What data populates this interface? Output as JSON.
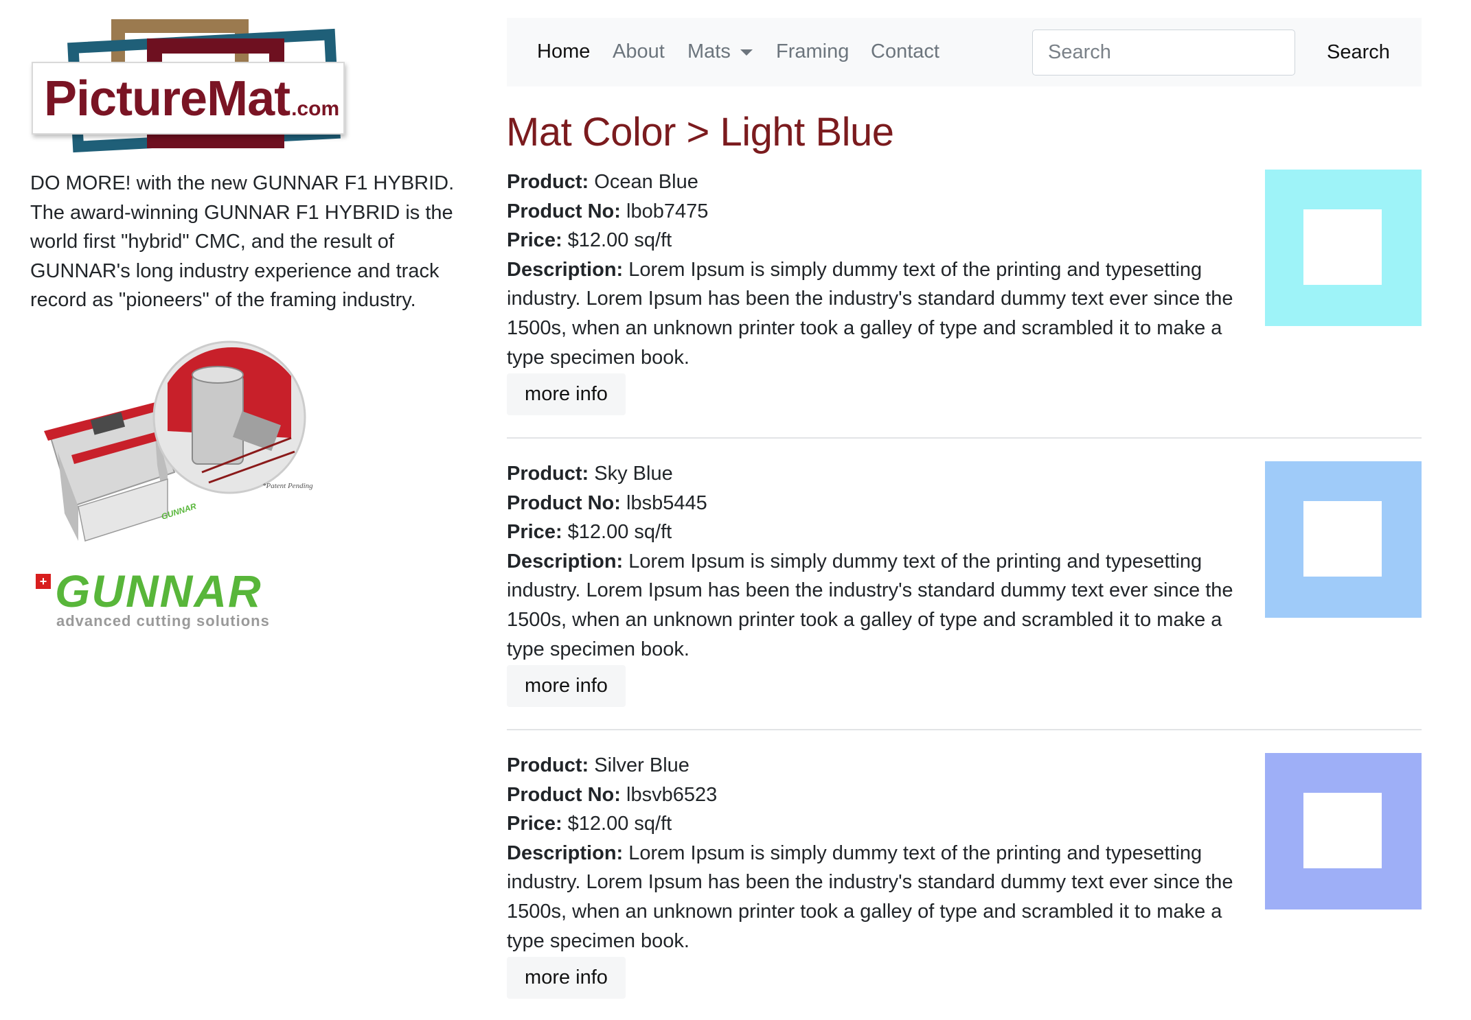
{
  "brand": {
    "logo_word": "PictureMat",
    "logo_suffix": ".com",
    "logo_colors": {
      "maroon": "#7a1424",
      "teal": "#1f5f78",
      "tan": "#9b7a4f"
    }
  },
  "sidebar": {
    "promo_text": "DO MORE! with the new GUNNAR F1 HYBRID. The award-winning GUNNAR F1 HYBRID is the world first \"hybrid\" CMC, and the result of GUNNAR's long industry experience and track record as \"pioneers\" of the framing industry.",
    "ad": {
      "brand_name": "GUNNAR",
      "tagline": "advanced cutting solutions",
      "patent_note": "*Patent Pending",
      "machine_mark": "GUNNAR",
      "brand_color": "#58b63a"
    }
  },
  "nav": {
    "items": [
      {
        "label": "Home",
        "active": true
      },
      {
        "label": "About",
        "active": false
      },
      {
        "label": "Mats",
        "active": false,
        "has_dropdown": true
      },
      {
        "label": "Framing",
        "active": false
      },
      {
        "label": "Contact",
        "active": false
      }
    ],
    "search": {
      "placeholder": "Search",
      "value": "",
      "button_label": "Search"
    }
  },
  "page": {
    "title": "Mat Color > Light Blue",
    "title_color": "#7b1b1e"
  },
  "labels": {
    "product": "Product:",
    "product_no": "Product No:",
    "price": "Price:",
    "description": "Description:",
    "more_info": "more info"
  },
  "products": [
    {
      "name": "Ocean Blue",
      "number": "lbob7475",
      "price": "$12.00 sq/ft",
      "description": "Lorem Ipsum is simply dummy text of the printing and typesetting industry. Lorem Ipsum has been the industry's standard dummy text ever since the 1500s, when an unknown printer took a galley of type and scrambled it to make a type specimen book.",
      "swatch_color": "#9ef3f8"
    },
    {
      "name": "Sky Blue",
      "number": "lbsb5445",
      "price": "$12.00 sq/ft",
      "description": "Lorem Ipsum is simply dummy text of the printing and typesetting industry. Lorem Ipsum has been the industry's standard dummy text ever since the 1500s, when an unknown printer took a galley of type and scrambled it to make a type specimen book.",
      "swatch_color": "#9fcbf9"
    },
    {
      "name": "Silver Blue",
      "number": "lbsvb6523",
      "price": "$12.00 sq/ft",
      "description": "Lorem Ipsum is simply dummy text of the printing and typesetting industry. Lorem Ipsum has been the industry's standard dummy text ever since the 1500s, when an unknown printer took a galley of type and scrambled it to make a type specimen book.",
      "swatch_color": "#9eaff7"
    }
  ]
}
